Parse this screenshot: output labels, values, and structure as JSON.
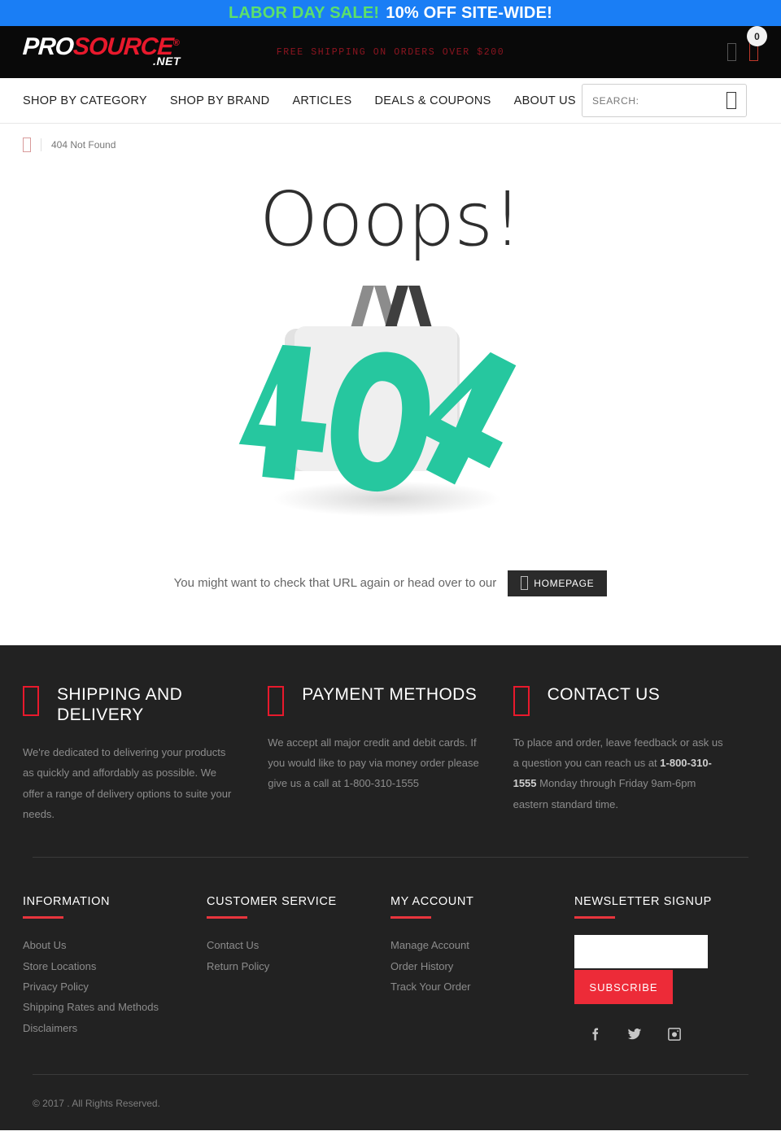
{
  "promo": {
    "highlight": "LABOR DAY SALE!",
    "rest": "10% OFF SITE-WIDE!",
    "bg_color": "#1a7ef5",
    "highlight_color": "#5ce06a"
  },
  "header": {
    "logo": {
      "part1": "PRO",
      "part2": "SOURCE",
      "registered": "®",
      "suffix": ".NET"
    },
    "shipping_notice": "FREE SHIPPING ON ORDERS OVER $200",
    "account_icon": "user-icon",
    "cart_icon": "cart-icon",
    "cart_count": "0"
  },
  "nav": {
    "items": [
      {
        "label": "SHOP BY CATEGORY"
      },
      {
        "label": "SHOP BY BRAND"
      },
      {
        "label": "ARTICLES"
      },
      {
        "label": "DEALS & COUPONS"
      },
      {
        "label": "ABOUT US"
      }
    ]
  },
  "search": {
    "placeholder": "SEARCH:",
    "value": "",
    "icon": "search-icon"
  },
  "breadcrumb": {
    "home_icon": "home-icon",
    "current": "404 Not Found"
  },
  "main": {
    "heading": "Ooops!",
    "message": "You might want to check that URL again or head over to our",
    "button_label": "HOMEPAGE",
    "button_icon": "home-icon",
    "illustration": {
      "name": "404-shopping-bag-illustration",
      "digits": [
        "4",
        "0",
        "4"
      ],
      "digit_color": "#26c79f",
      "bag_color": "#ededed",
      "handle_colors": [
        "#8c8c8c",
        "#3f3f3f"
      ]
    }
  },
  "features": [
    {
      "icon": "truck-icon",
      "title": "SHIPPING AND DELIVERY",
      "body": "We're dedicated to delivering your products as quickly and affordably as possible. We offer a range of delivery options to suite your needs."
    },
    {
      "icon": "credit-card-icon",
      "title": "PAYMENT METHODS",
      "body": "We accept all major credit and debit cards. If you would like to pay via money order please give us a call at 1-800-310-1555"
    },
    {
      "icon": "phone-icon",
      "title": "CONTACT US",
      "body_pre": "To place and order, leave feedback or ask us a question you can reach us at ",
      "body_phone": "1-800-310-1555",
      "body_post": " Monday through Friday 9am-6pm eastern standard time."
    }
  ],
  "footer_columns": [
    {
      "title": "INFORMATION",
      "links": [
        "About Us",
        "Store Locations",
        "Privacy Policy",
        "Shipping Rates and Methods",
        "Disclaimers"
      ]
    },
    {
      "title": "CUSTOMER SERVICE",
      "links": [
        "Contact Us",
        "Return Policy"
      ]
    },
    {
      "title": "MY ACCOUNT",
      "links": [
        "Manage Account",
        "Order History",
        "Track Your Order"
      ]
    }
  ],
  "newsletter": {
    "title": "NEWSLETTER SIGNUP",
    "input_value": "",
    "input_placeholder": "",
    "button_label": "SUBSCRIBE",
    "button_color": "#ed2b38",
    "socials": [
      {
        "name": "facebook-icon"
      },
      {
        "name": "twitter-icon"
      },
      {
        "name": "instagram-icon"
      }
    ]
  },
  "copyright": "© 2017 . All Rights Reserved."
}
